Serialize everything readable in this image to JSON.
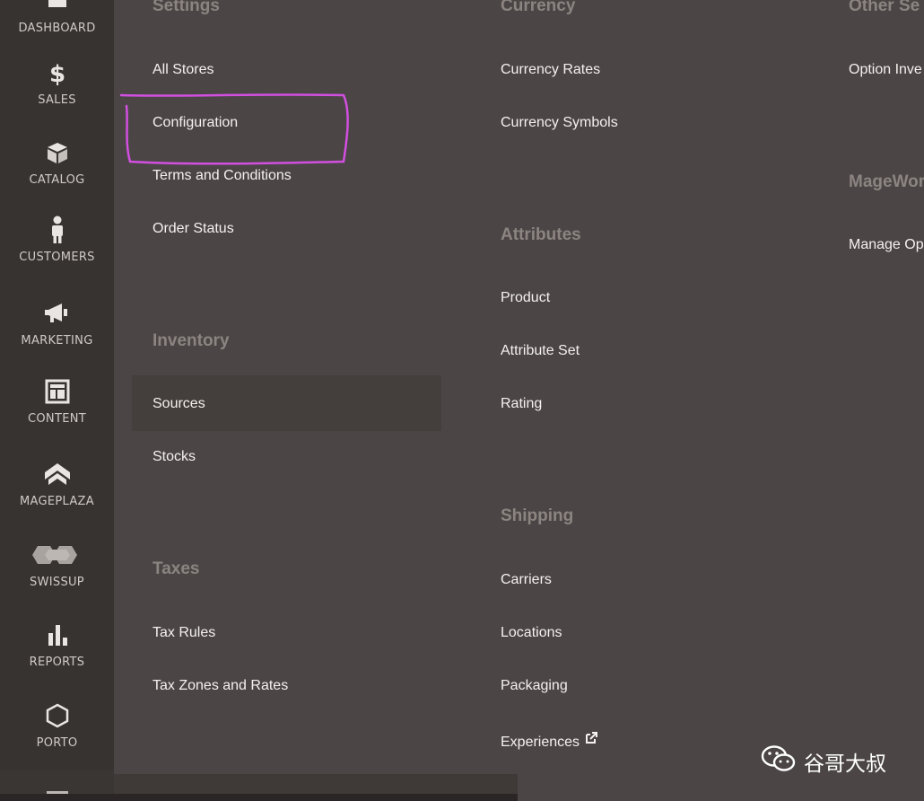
{
  "nav": {
    "items": [
      {
        "label": "DASHBOARD",
        "icon": "dashboard-icon"
      },
      {
        "label": "SALES",
        "icon": "dollar-icon"
      },
      {
        "label": "CATALOG",
        "icon": "box-icon"
      },
      {
        "label": "CUSTOMERS",
        "icon": "person-icon"
      },
      {
        "label": "MARKETING",
        "icon": "megaphone-icon"
      },
      {
        "label": "CONTENT",
        "icon": "layout-icon"
      },
      {
        "label": "MAGEPLAZA",
        "icon": "mageplaza-icon"
      },
      {
        "label": "SWISSUP",
        "icon": "swissup-icon"
      },
      {
        "label": "REPORTS",
        "icon": "bar-chart-icon"
      },
      {
        "label": "PORTO",
        "icon": "hexagon-icon"
      }
    ]
  },
  "menu": {
    "settings": {
      "title": "Settings",
      "links": [
        "All Stores",
        "Configuration",
        "Terms and Conditions",
        "Order Status"
      ]
    },
    "inventory": {
      "title": "Inventory",
      "links": [
        "Sources",
        "Stocks"
      ]
    },
    "taxes": {
      "title": "Taxes",
      "links": [
        "Tax Rules",
        "Tax Zones and Rates"
      ]
    },
    "currency": {
      "title": "Currency",
      "links": [
        "Currency Rates",
        "Currency Symbols"
      ]
    },
    "attributes": {
      "title": "Attributes",
      "links": [
        "Product",
        "Attribute Set",
        "Rating"
      ]
    },
    "shipping": {
      "title": "Shipping",
      "links": [
        "Carriers",
        "Locations",
        "Packaging",
        "Experiences"
      ]
    },
    "other": {
      "title": "Other Se",
      "links": [
        "Option Inve"
      ]
    },
    "mageworx": {
      "title": "MageWor",
      "links": [
        "Manage Op"
      ]
    }
  },
  "annotation": {
    "color": "#d24fe0"
  },
  "watermark": {
    "text": "谷哥大叔",
    "icon": "wechat-icon"
  }
}
